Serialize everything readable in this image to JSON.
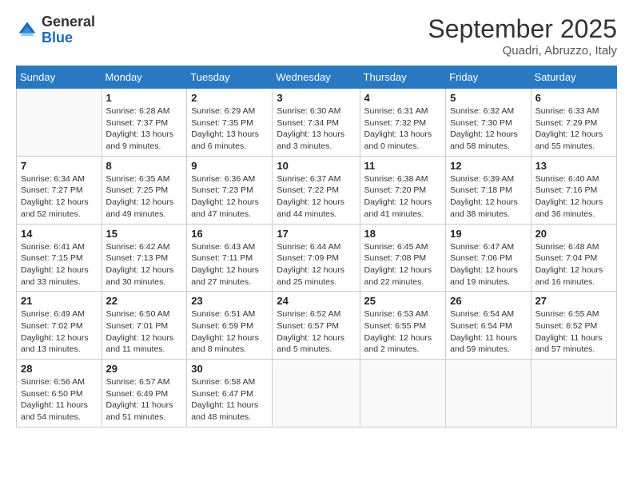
{
  "logo": {
    "general": "General",
    "blue": "Blue"
  },
  "title": "September 2025",
  "location": "Quadri, Abruzzo, Italy",
  "days_of_week": [
    "Sunday",
    "Monday",
    "Tuesday",
    "Wednesday",
    "Thursday",
    "Friday",
    "Saturday"
  ],
  "weeks": [
    [
      {
        "day": "",
        "info": ""
      },
      {
        "day": "1",
        "info": "Sunrise: 6:28 AM\nSunset: 7:37 PM\nDaylight: 13 hours\nand 9 minutes."
      },
      {
        "day": "2",
        "info": "Sunrise: 6:29 AM\nSunset: 7:35 PM\nDaylight: 13 hours\nand 6 minutes."
      },
      {
        "day": "3",
        "info": "Sunrise: 6:30 AM\nSunset: 7:34 PM\nDaylight: 13 hours\nand 3 minutes."
      },
      {
        "day": "4",
        "info": "Sunrise: 6:31 AM\nSunset: 7:32 PM\nDaylight: 13 hours\nand 0 minutes."
      },
      {
        "day": "5",
        "info": "Sunrise: 6:32 AM\nSunset: 7:30 PM\nDaylight: 12 hours\nand 58 minutes."
      },
      {
        "day": "6",
        "info": "Sunrise: 6:33 AM\nSunset: 7:29 PM\nDaylight: 12 hours\nand 55 minutes."
      }
    ],
    [
      {
        "day": "7",
        "info": "Sunrise: 6:34 AM\nSunset: 7:27 PM\nDaylight: 12 hours\nand 52 minutes."
      },
      {
        "day": "8",
        "info": "Sunrise: 6:35 AM\nSunset: 7:25 PM\nDaylight: 12 hours\nand 49 minutes."
      },
      {
        "day": "9",
        "info": "Sunrise: 6:36 AM\nSunset: 7:23 PM\nDaylight: 12 hours\nand 47 minutes."
      },
      {
        "day": "10",
        "info": "Sunrise: 6:37 AM\nSunset: 7:22 PM\nDaylight: 12 hours\nand 44 minutes."
      },
      {
        "day": "11",
        "info": "Sunrise: 6:38 AM\nSunset: 7:20 PM\nDaylight: 12 hours\nand 41 minutes."
      },
      {
        "day": "12",
        "info": "Sunrise: 6:39 AM\nSunset: 7:18 PM\nDaylight: 12 hours\nand 38 minutes."
      },
      {
        "day": "13",
        "info": "Sunrise: 6:40 AM\nSunset: 7:16 PM\nDaylight: 12 hours\nand 36 minutes."
      }
    ],
    [
      {
        "day": "14",
        "info": "Sunrise: 6:41 AM\nSunset: 7:15 PM\nDaylight: 12 hours\nand 33 minutes."
      },
      {
        "day": "15",
        "info": "Sunrise: 6:42 AM\nSunset: 7:13 PM\nDaylight: 12 hours\nand 30 minutes."
      },
      {
        "day": "16",
        "info": "Sunrise: 6:43 AM\nSunset: 7:11 PM\nDaylight: 12 hours\nand 27 minutes."
      },
      {
        "day": "17",
        "info": "Sunrise: 6:44 AM\nSunset: 7:09 PM\nDaylight: 12 hours\nand 25 minutes."
      },
      {
        "day": "18",
        "info": "Sunrise: 6:45 AM\nSunset: 7:08 PM\nDaylight: 12 hours\nand 22 minutes."
      },
      {
        "day": "19",
        "info": "Sunrise: 6:47 AM\nSunset: 7:06 PM\nDaylight: 12 hours\nand 19 minutes."
      },
      {
        "day": "20",
        "info": "Sunrise: 6:48 AM\nSunset: 7:04 PM\nDaylight: 12 hours\nand 16 minutes."
      }
    ],
    [
      {
        "day": "21",
        "info": "Sunrise: 6:49 AM\nSunset: 7:02 PM\nDaylight: 12 hours\nand 13 minutes."
      },
      {
        "day": "22",
        "info": "Sunrise: 6:50 AM\nSunset: 7:01 PM\nDaylight: 12 hours\nand 11 minutes."
      },
      {
        "day": "23",
        "info": "Sunrise: 6:51 AM\nSunset: 6:59 PM\nDaylight: 12 hours\nand 8 minutes."
      },
      {
        "day": "24",
        "info": "Sunrise: 6:52 AM\nSunset: 6:57 PM\nDaylight: 12 hours\nand 5 minutes."
      },
      {
        "day": "25",
        "info": "Sunrise: 6:53 AM\nSunset: 6:55 PM\nDaylight: 12 hours\nand 2 minutes."
      },
      {
        "day": "26",
        "info": "Sunrise: 6:54 AM\nSunset: 6:54 PM\nDaylight: 11 hours\nand 59 minutes."
      },
      {
        "day": "27",
        "info": "Sunrise: 6:55 AM\nSunset: 6:52 PM\nDaylight: 11 hours\nand 57 minutes."
      }
    ],
    [
      {
        "day": "28",
        "info": "Sunrise: 6:56 AM\nSunset: 6:50 PM\nDaylight: 11 hours\nand 54 minutes."
      },
      {
        "day": "29",
        "info": "Sunrise: 6:57 AM\nSunset: 6:49 PM\nDaylight: 11 hours\nand 51 minutes."
      },
      {
        "day": "30",
        "info": "Sunrise: 6:58 AM\nSunset: 6:47 PM\nDaylight: 11 hours\nand 48 minutes."
      },
      {
        "day": "",
        "info": ""
      },
      {
        "day": "",
        "info": ""
      },
      {
        "day": "",
        "info": ""
      },
      {
        "day": "",
        "info": ""
      }
    ]
  ]
}
